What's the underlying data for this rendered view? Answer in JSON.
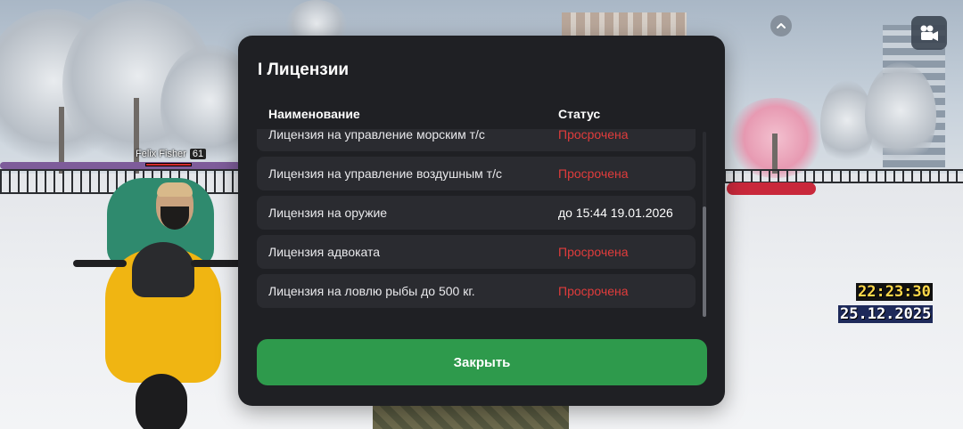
{
  "modal": {
    "title": "I Лицензии",
    "columns": {
      "name": "Наименование",
      "status": "Статус"
    },
    "rows": [
      {
        "name": "Лицензия на управление морским т/с",
        "status": "Просрочена",
        "status_color": "#e03c3c"
      },
      {
        "name": "Лицензия на управление воздушным т/с",
        "status": "Просрочена",
        "status_color": "#e03c3c"
      },
      {
        "name": "Лицензия на оружие",
        "status": "до 15:44 19.01.2026",
        "status_color": "#ffffff"
      },
      {
        "name": "Лицензия адвоката",
        "status": "Просрочена",
        "status_color": "#e03c3c"
      },
      {
        "name": "Лицензия на ловлю рыбы до 500 кг.",
        "status": "Просрочена",
        "status_color": "#e03c3c"
      }
    ],
    "close_label": "Закрыть",
    "close_color": "#2e9a4c"
  },
  "hud": {
    "player_name": "Felix Fisher",
    "player_level": "61",
    "time": "22:23:30",
    "date": "25.12.2025",
    "up_icon": "chevron-up-icon",
    "camera_icon": "video-camera-icon"
  }
}
